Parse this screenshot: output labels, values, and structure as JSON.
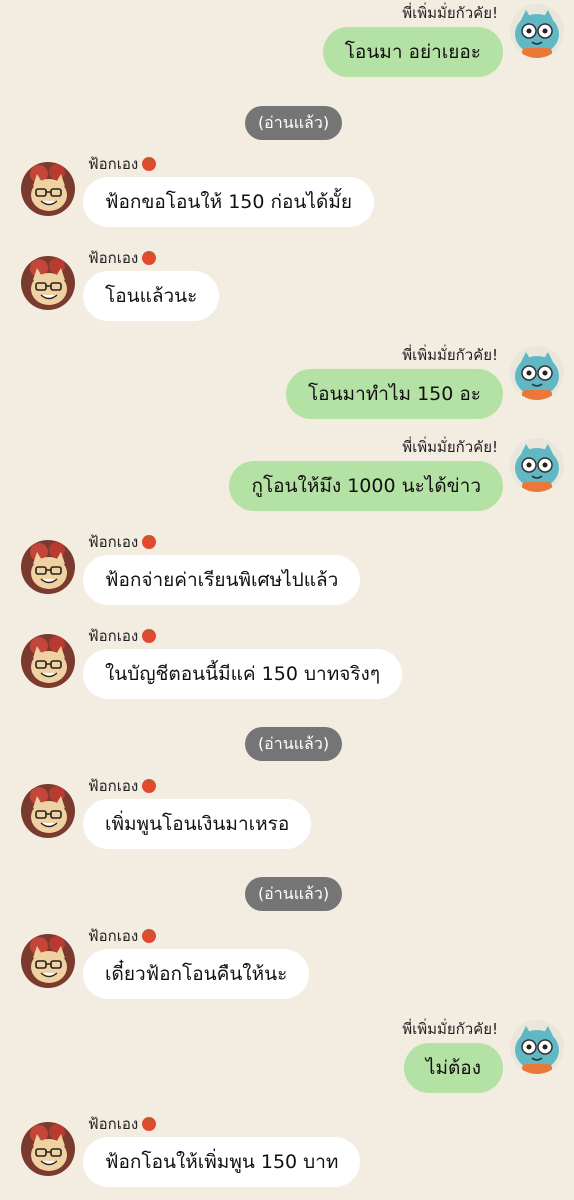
{
  "colors": {
    "background": "#f2ece1",
    "outgoing_bubble": "#b4e1a4",
    "incoming_bubble": "#ffffff",
    "read_pill": "#757575"
  },
  "contacts": {
    "self_name": "พี่เพิ่มมั่ยกัวคัย!",
    "self_avatar_icon": "blue-bird-sticker-avatar",
    "other_name": "ฟ้อกเอง",
    "other_name_emoji_icon": "tomato-icon",
    "other_avatar_icon": "cartoon-cat-with-glasses-avatar"
  },
  "messages": [
    {
      "direction": "out",
      "text": "โอนมา อย่าเยอะ"
    },
    {
      "type": "read_receipt",
      "text": "(อ่านแล้ว)"
    },
    {
      "direction": "in",
      "text": "ฟ้อกขอโอนให้ 150 ก่อนได้มั้ย"
    },
    {
      "direction": "in",
      "text": "โอนแล้วนะ"
    },
    {
      "direction": "out",
      "text": "โอนมาทำไม 150 อะ"
    },
    {
      "direction": "out",
      "text": "กูโอนให้มึง 1000 นะได้ข่าว"
    },
    {
      "direction": "in",
      "text": "ฟ้อกจ่ายค่าเรียนพิเศษไปแล้ว"
    },
    {
      "direction": "in",
      "text": "ในบัญชีตอนนี้มีแค่ 150 บาทจริงๆ"
    },
    {
      "type": "read_receipt",
      "text": "(อ่านแล้ว)"
    },
    {
      "direction": "in",
      "text": "เพิ่มพูนโอนเงินมาเหรอ"
    },
    {
      "type": "read_receipt",
      "text": "(อ่านแล้ว)"
    },
    {
      "direction": "in",
      "text": "เดี๋ยวฟ้อกโอนคืนให้นะ"
    },
    {
      "direction": "out",
      "text": "ไม่ต้อง"
    },
    {
      "direction": "in",
      "text": "ฟ้อกโอนให้เพิ่มพูน 150 บาท"
    }
  ]
}
